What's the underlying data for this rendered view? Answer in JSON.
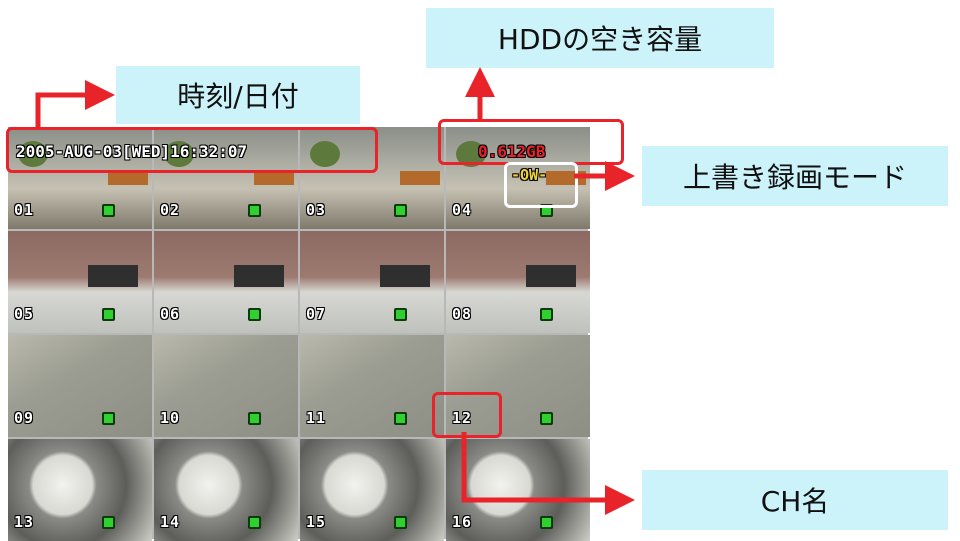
{
  "callouts": {
    "datetime": "時刻/日付",
    "hdd_free": "HDDの空き容量",
    "overwrite_mode": "上書き録画モード",
    "channel_name": "CH名"
  },
  "osd": {
    "datetime": "2005-AUG-03[WED]16:32:07",
    "hdd_free": "0.612GB",
    "overwrite": "-OW-"
  },
  "channels": [
    "01",
    "02",
    "03",
    "04",
    "05",
    "06",
    "07",
    "08",
    "09",
    "10",
    "11",
    "12",
    "13",
    "14",
    "15",
    "16"
  ],
  "colors": {
    "callout_bg": "#ccf2fa",
    "highlight_red": "#e8232a",
    "record_indicator": "#2fd02f"
  }
}
